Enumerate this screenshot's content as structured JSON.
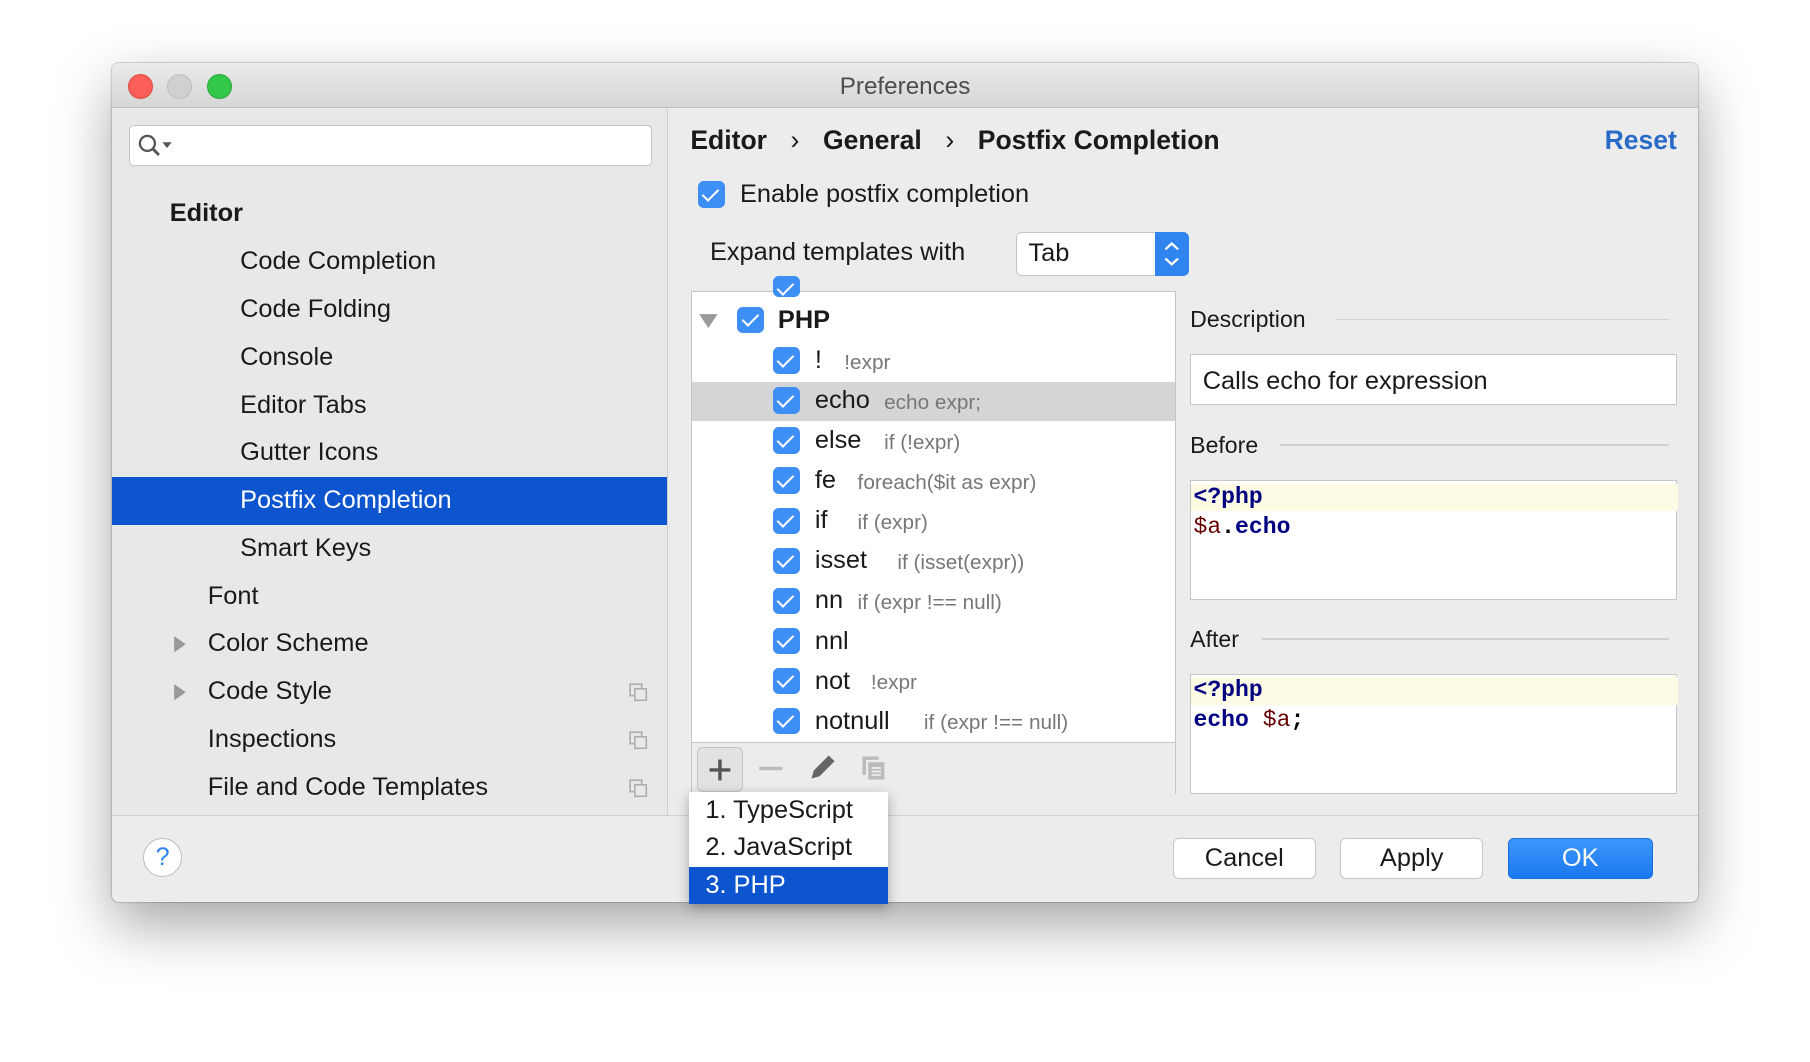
{
  "window": {
    "title": "Preferences"
  },
  "search": {
    "placeholder": "",
    "value": ""
  },
  "sidebar": {
    "group": "Editor",
    "items": [
      {
        "label": "Code Completion"
      },
      {
        "label": "Code Folding"
      },
      {
        "label": "Console"
      },
      {
        "label": "Editor Tabs"
      },
      {
        "label": "Gutter Icons"
      },
      {
        "label": "Postfix Completion",
        "selected": true
      },
      {
        "label": "Smart Keys"
      }
    ],
    "top_items": [
      {
        "label": "Font"
      },
      {
        "label": "Color Scheme",
        "expandable": true
      },
      {
        "label": "Code Style",
        "expandable": true,
        "copy_icon": true
      },
      {
        "label": "Inspections",
        "copy_icon": true
      },
      {
        "label": "File and Code Templates",
        "copy_icon": true
      }
    ]
  },
  "breadcrumb": [
    "Editor",
    "General",
    "Postfix Completion"
  ],
  "reset_label": "Reset",
  "enable": {
    "label": "Enable postfix completion",
    "checked": true
  },
  "expand": {
    "label": "Expand templates with",
    "value": "Tab"
  },
  "tree": {
    "group": "PHP",
    "rows": [
      {
        "key": "!",
        "desc": "!expr"
      },
      {
        "key": "echo",
        "desc": "echo expr;",
        "selected": true
      },
      {
        "key": "else",
        "desc": "if (!expr)"
      },
      {
        "key": "fe",
        "desc": "foreach($it as expr)"
      },
      {
        "key": "if",
        "desc": "if (expr)"
      },
      {
        "key": "isset",
        "desc": "if (isset(expr))"
      },
      {
        "key": "nn",
        "desc": "if (expr !== null)"
      },
      {
        "key": "nnl",
        "desc": ""
      },
      {
        "key": "not",
        "desc": "!expr"
      },
      {
        "key": "notnull",
        "desc": "if (expr !== null)"
      }
    ]
  },
  "popup": {
    "items": [
      "1. TypeScript",
      "2. JavaScript",
      "3. PHP"
    ],
    "selected_index": 2
  },
  "description": {
    "label": "Description",
    "text": "Calls echo for expression"
  },
  "before": {
    "label": "Before",
    "line1": "<?php",
    "var": "$a",
    "dot": ".",
    "method": "echo"
  },
  "after": {
    "label": "After",
    "line1": "<?php",
    "kw": "echo",
    "var": "$a",
    "semi": ";"
  },
  "buttons": {
    "cancel": "Cancel",
    "apply": "Apply",
    "ok": "OK",
    "help": "?"
  },
  "colors": {
    "accent": "#0d55cf",
    "ok": "#1a82f7",
    "checkbox": "#3d8ef5",
    "reset": "#2a6bc9"
  }
}
